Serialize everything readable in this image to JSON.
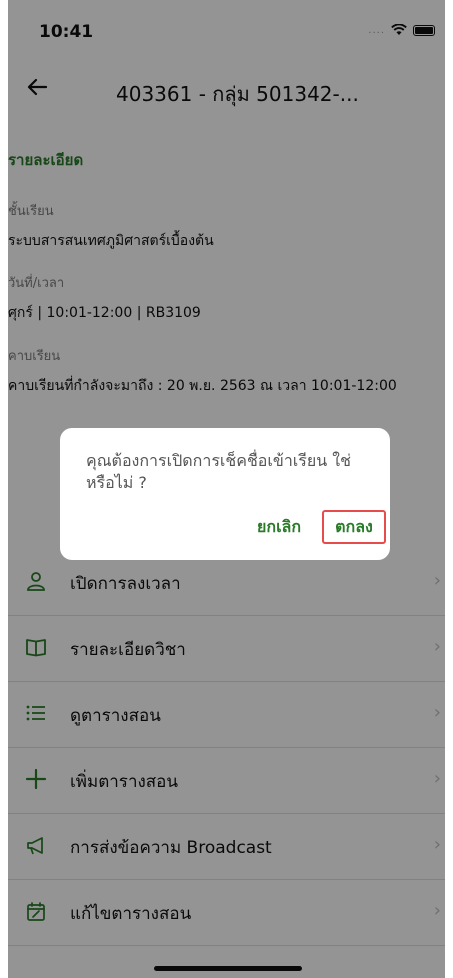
{
  "status": {
    "time": "10:41",
    "signal_dots": "....",
    "wifi_icon": "wifi-icon",
    "battery_icon": "battery-icon"
  },
  "header": {
    "back_icon": "back-arrow-icon",
    "title": "403361 - กลุ่ม 501342-..."
  },
  "details": {
    "section_title": "รายละเอียด",
    "class_label": "ชั้นเรียน",
    "class_value": "ระบบสารสนเทศภูมิศาสตร์เบื้องต้น",
    "datetime_label": "วันที่/เวลา",
    "datetime_value": "ศุกร์  |  10:01-12:00  |  RB3109",
    "period_label": "คาบเรียน",
    "period_value": "คาบเรียนที่กำลังจะมาถึง : 20 พ.ย. 2563 ณ เวลา 10:01-12:00"
  },
  "menu": {
    "items": [
      {
        "icon": "person-icon",
        "label": "เปิดการลงเวลา"
      },
      {
        "icon": "book-icon",
        "label": "รายละเอียดวิชา"
      },
      {
        "icon": "list-icon",
        "label": "ดูตารางสอน"
      },
      {
        "icon": "plus-icon",
        "label": "เพิ่มตารางสอน"
      },
      {
        "icon": "megaphone-icon",
        "label": "การส่งข้อความ Broadcast"
      },
      {
        "icon": "calendar-edit-icon",
        "label": "แก้ไขตารางสอน"
      }
    ]
  },
  "dialog": {
    "message": "คุณต้องการเปิดการเช็คชื่อเข้าเรียน ใช่หรือไม่ ?",
    "cancel_label": "ยกเลิก",
    "ok_label": "ตกลง"
  },
  "colors": {
    "accent_green": "#2a7a2a",
    "highlight_red": "#e74c4c"
  }
}
